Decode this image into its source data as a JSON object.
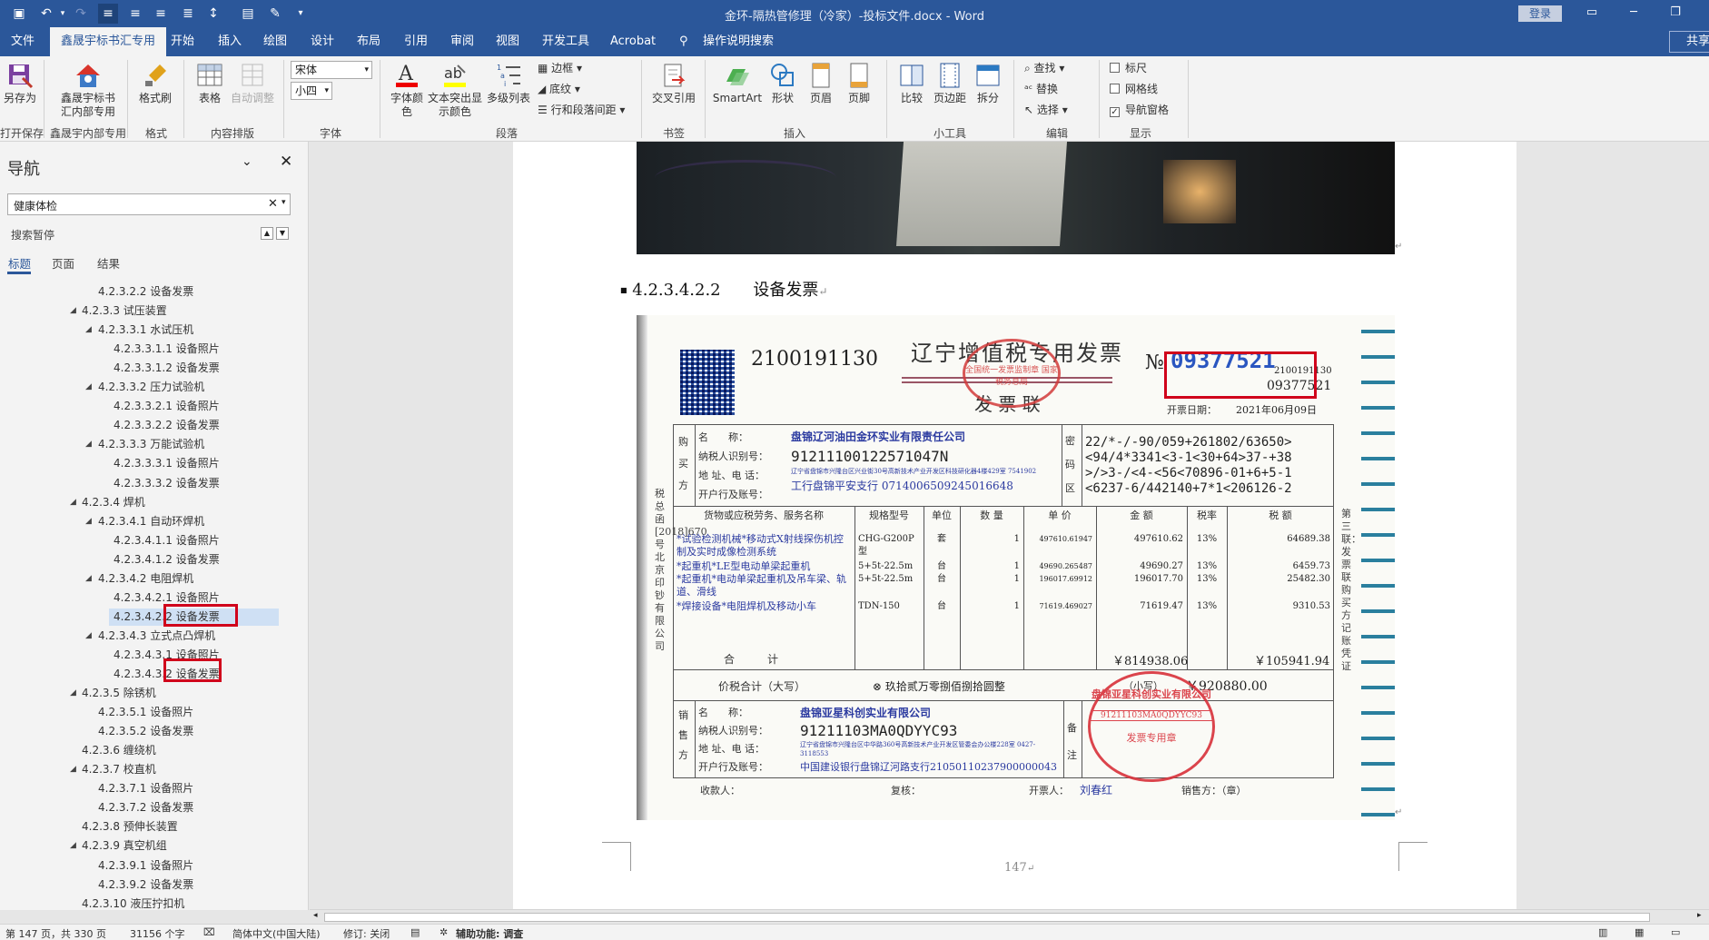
{
  "titlebar": {
    "title": "金环-隔热管修理（冷家）-投标文件.docx  -  Word",
    "login_label": "登录"
  },
  "menu": {
    "tabs": [
      "文件",
      "鑫晟宇标书汇专用",
      "开始",
      "插入",
      "绘图",
      "设计",
      "布局",
      "引用",
      "审阅",
      "视图",
      "开发工具",
      "Acrobat"
    ],
    "active_tab": "鑫晟宇标书汇专用",
    "tell_me": "操作说明搜索",
    "share": "共享"
  },
  "ribbon": {
    "saveas": "另存为",
    "open_save_group": "打开保存",
    "xsy_button_l1": "鑫晟宇标书",
    "xsy_button_l2": "汇内部专用",
    "xsy_group": "鑫晟宇内部专用",
    "format_painter": "格式刷",
    "format_group": "格式",
    "table": "表格",
    "auto_adjust": "自动调整",
    "content_group": "内容排版",
    "font_name": "宋体",
    "font_size": "小四",
    "font_group": "字体",
    "font_color_l1": "字体颜",
    "font_color_l2": "色",
    "highlight_l1": "文本突出显",
    "highlight_l2": "示颜色",
    "multilevel": "多级列表",
    "border": "边框",
    "shading": "底纹",
    "line_spacing": "行和段落间距",
    "para_group": "段落",
    "crossref": "交叉引用",
    "bookmark_group": "书签",
    "smartart": "SmartArt",
    "shape": "形状",
    "header": "页眉",
    "footer": "页脚",
    "insert_group": "插入",
    "compare": "比较",
    "margins": "页边距",
    "split": "拆分",
    "tools_group": "小工具",
    "find": "查找",
    "replace": "替换",
    "select": "选择",
    "edit_group": "编辑",
    "ruler": "标尺",
    "gridlines": "网格线",
    "nav_pane": "导航窗格",
    "show_group": "显示",
    "ruler_checked": false,
    "grid_checked": false,
    "navpane_checked": true
  },
  "nav": {
    "title": "导航",
    "search_value": "健康体检",
    "paused": "搜索暂停",
    "tabs": [
      "标题",
      "页面",
      "结果"
    ],
    "active_tab": "标题",
    "items": [
      {
        "text": "4.2.3.2.2 设备发票",
        "indent": 3,
        "arrow": false
      },
      {
        "text": "4.2.3.3 试压装置",
        "indent": 2,
        "arrow": true
      },
      {
        "text": "4.2.3.3.1 水试压机",
        "indent": 3,
        "arrow": true
      },
      {
        "text": "4.2.3.3.1.1 设备照片",
        "indent": 4,
        "arrow": false
      },
      {
        "text": "4.2.3.3.1.2 设备发票",
        "indent": 4,
        "arrow": false
      },
      {
        "text": "4.2.3.3.2 压力试验机",
        "indent": 3,
        "arrow": true
      },
      {
        "text": "4.2.3.3.2.1 设备照片",
        "indent": 4,
        "arrow": false
      },
      {
        "text": "4.2.3.3.2.2 设备发票",
        "indent": 4,
        "arrow": false
      },
      {
        "text": "4.2.3.3.3 万能试验机",
        "indent": 3,
        "arrow": true
      },
      {
        "text": "4.2.3.3.3.1 设备照片",
        "indent": 4,
        "arrow": false
      },
      {
        "text": "4.2.3.3.3.2 设备发票",
        "indent": 4,
        "arrow": false
      },
      {
        "text": "4.2.3.4 焊机",
        "indent": 2,
        "arrow": true
      },
      {
        "text": "4.2.3.4.1 自动环焊机",
        "indent": 3,
        "arrow": true
      },
      {
        "text": "4.2.3.4.1.1 设备照片",
        "indent": 4,
        "arrow": false
      },
      {
        "text": "4.2.3.4.1.2 设备发票",
        "indent": 4,
        "arrow": false
      },
      {
        "text": "4.2.3.4.2 电阻焊机",
        "indent": 3,
        "arrow": true
      },
      {
        "text": "4.2.3.4.2.1 设备照片",
        "indent": 4,
        "arrow": false
      },
      {
        "text": "4.2.3.4.2.2 设备发票",
        "indent": 4,
        "arrow": false,
        "selected": true
      },
      {
        "text": "4.2.3.4.3 立式点凸焊机",
        "indent": 3,
        "arrow": true
      },
      {
        "text": "4.2.3.4.3.1 设备照片",
        "indent": 4,
        "arrow": false
      },
      {
        "text": "4.2.3.4.3.2 设备发票",
        "indent": 4,
        "arrow": false
      },
      {
        "text": "4.2.3.5 除锈机",
        "indent": 2,
        "arrow": true
      },
      {
        "text": "4.2.3.5.1 设备照片",
        "indent": 3,
        "arrow": false
      },
      {
        "text": "4.2.3.5.2 设备发票",
        "indent": 3,
        "arrow": false
      },
      {
        "text": "4.2.3.6 缠绕机",
        "indent": 2,
        "arrow": false
      },
      {
        "text": "4.2.3.7 校直机",
        "indent": 2,
        "arrow": true
      },
      {
        "text": "4.2.3.7.1 设备照片",
        "indent": 3,
        "arrow": false
      },
      {
        "text": "4.2.3.7.2 设备发票",
        "indent": 3,
        "arrow": false
      },
      {
        "text": "4.2.3.8 预伸长装置",
        "indent": 2,
        "arrow": false
      },
      {
        "text": "4.2.3.9 真空机组",
        "indent": 2,
        "arrow": true
      },
      {
        "text": "4.2.3.9.1 设备照片",
        "indent": 3,
        "arrow": false
      },
      {
        "text": "4.2.3.9.2 设备发票",
        "indent": 3,
        "arrow": false
      },
      {
        "text": "4.2.3.10 液压拧扣机",
        "indent": 2,
        "arrow": false
      }
    ]
  },
  "document": {
    "heading_num": "4.2.3.4.2.2",
    "heading_text": "设备发票",
    "page_number": "147",
    "invoice": {
      "code": "2100191130",
      "title": "辽宁增值税专用发票",
      "subtitle": "发 票 联",
      "number": "09377521",
      "number_small_code": "2100191130",
      "number_small_no": "09377521",
      "no_label": "№",
      "date_label": "开票日期：",
      "date": "2021年06月09日",
      "buyer_label": "购买方",
      "buyer_name_label": "名　　称：",
      "buyer_name": "盘锦辽河油田金环实业有限责任公司",
      "buyer_tax_label": "纳税人识别号：",
      "buyer_tax": "91211100122571047N",
      "buyer_addr_label": "地 址、电 话：",
      "buyer_addr": "辽宁省盘锦市兴隆台区兴业街30号高新技术产业开发区科技研化器4楼429室 7541902",
      "buyer_bank_label": "开户行及账号：",
      "buyer_bank": "工行盘锦平安支行 0714006509245016648",
      "cipher_label": "密码区",
      "cipher": [
        "22/*-/-90/059+261802/63650>",
        "<94/4*3341<3-1<30+64>37-+38",
        ">/>3-/<4-<56<70896-01+6+5-1",
        "<6237-6/442140+7*1<206126-2"
      ],
      "col_headers": [
        "货物或应税劳务、服务名称",
        "规格型号",
        "单位",
        "数 量",
        "单 价",
        "金 额",
        "税率",
        "税 额"
      ],
      "rows": [
        {
          "name": "*试验检测机械*移动式X射线探伤机控制及实时成像检测系统",
          "spec": "CHG-G200P型",
          "unit": "套",
          "qty": "1",
          "price": "497610.61947",
          "amount": "497610.62",
          "rate": "13%",
          "tax": "64689.38"
        },
        {
          "name": "*起重机*LE型电动单梁起重机",
          "spec": "5+5t-22.5m",
          "unit": "台",
          "qty": "1",
          "price": "49690.265487",
          "amount": "49690.27",
          "rate": "13%",
          "tax": "6459.73"
        },
        {
          "name": "*起重机*电动单梁起重机及吊车梁、轨道、滑线",
          "spec": "5+5t-22.5m",
          "unit": "台",
          "qty": "1",
          "price": "196017.69912",
          "amount": "196017.70",
          "rate": "13%",
          "tax": "25482.30"
        },
        {
          "name": "*焊接设备*电阻焊机及移动小车",
          "spec": "TDN-150",
          "unit": "台",
          "qty": "1",
          "price": "71619.469027",
          "amount": "71619.47",
          "rate": "13%",
          "tax": "9310.53"
        }
      ],
      "total_label": "合　　　计",
      "total_amount": "￥814938.06",
      "total_tax": "￥105941.94",
      "grand_label": "价税合计（大写）",
      "grand_words": "玖拾贰万零捌佰捌拾圆整",
      "grand_small_label": "（小写）",
      "grand_number": "￥920880.00",
      "seller_label": "销售方",
      "seller_name_label": "名　　称：",
      "seller_name": "盘锦亚星科创实业有限公司",
      "seller_tax_label": "纳税人识别号：",
      "seller_tax": "91211103MA0QDYYC93",
      "seller_addr_label": "地 址、电 话：",
      "seller_addr": "辽宁省盘锦市兴隆台区中华路360号高新技术产业开发区管委会办公楼228室 0427-3118553",
      "seller_bank_label": "开户行及账号：",
      "seller_bank": "中国建设银行盘锦辽河路支行21050110237900000043",
      "remark_label": "备注",
      "payee_label": "收款人：",
      "review_label": "复核：",
      "drawer_label": "开票人：",
      "drawer": "刘春红",
      "seller_sign_label": "销售方：（章）",
      "side_left": "税总函[2018]670号北京印钞有限公司",
      "side_right": "第三联：发票联 购买方记账凭证",
      "stamp_buyer": "全国统一发票监制章 国家税务总局",
      "stamp_seller": "91211103MA0QDYYC93",
      "stamp_seller_name": "盘锦亚星科创实业有限公司",
      "stamp_seller_bottom": "发票专用章"
    }
  },
  "statusbar": {
    "page": "第 147 页，共 330 页",
    "words": "31156 个字",
    "lang": "简体中文(中国大陆)",
    "track": "修订: 关闭",
    "accessibility": "辅助功能: 调查"
  }
}
